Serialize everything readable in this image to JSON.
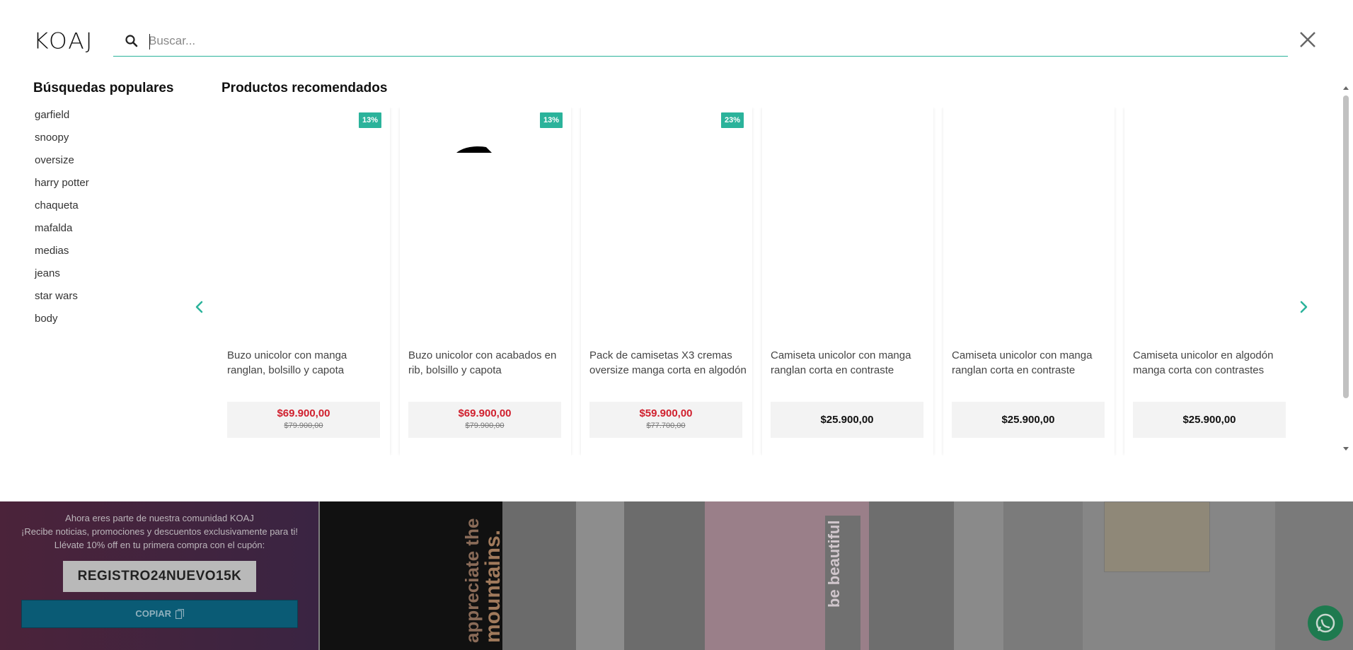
{
  "header": {
    "logo": "KOAJ",
    "search_placeholder": "Buscar...",
    "search_value": ""
  },
  "popular": {
    "title": "Búsquedas populares",
    "items": [
      "garfield",
      "snoopy",
      "oversize",
      "harry potter",
      "chaqueta",
      "mafalda",
      "medias",
      "jeans",
      "star wars",
      "body"
    ]
  },
  "recommended": {
    "title": "Productos recomendados",
    "products": [
      {
        "name": "Buzo unicolor con manga ranglan, bolsillo y capota",
        "badge": "13%",
        "price": "$69.900,00",
        "old_price": "$79.900,00"
      },
      {
        "name": "Buzo unicolor con acabados en rib, bolsillo y capota",
        "badge": "13%",
        "price": "$69.900,00",
        "old_price": "$79.900,00"
      },
      {
        "name": "Pack de camisetas X3 cremas oversize manga corta en algodón",
        "badge": "23%",
        "price": "$59.900,00",
        "old_price": "$77.700,00"
      },
      {
        "name": "Camiseta unicolor con manga ranglan corta en contraste",
        "badge": "",
        "price": "$25.900,00",
        "old_price": ""
      },
      {
        "name": "Camiseta unicolor con manga ranglan corta en contraste",
        "badge": "",
        "price": "$25.900,00",
        "old_price": ""
      },
      {
        "name": "Camiseta unicolor en algodón manga corta con contrastes",
        "badge": "",
        "price": "$25.900,00",
        "old_price": ""
      }
    ]
  },
  "promo": {
    "line1": "Ahora eres parte de nuestra comunidad KOAJ",
    "line2": "¡Recibe noticias, promociones y descuentos exclusivamente para ti! Llévate 10% off en tu primera compra con el cupón:",
    "coupon_code": "REGISTRO24NUEVO15K",
    "copy_label": "COPIAR"
  },
  "background_text": {
    "tile1_a": "appreciate the",
    "tile1_b": "mountains.",
    "tile2": "be beautiful"
  },
  "colors": {
    "accent": "#2bb39b",
    "sale": "#d0202e",
    "copy_button": "#0a5b75"
  },
  "icons": [
    "search-icon",
    "close-icon",
    "chevron-left-icon",
    "chevron-right-icon",
    "copy-icon",
    "whatsapp-icon"
  ]
}
